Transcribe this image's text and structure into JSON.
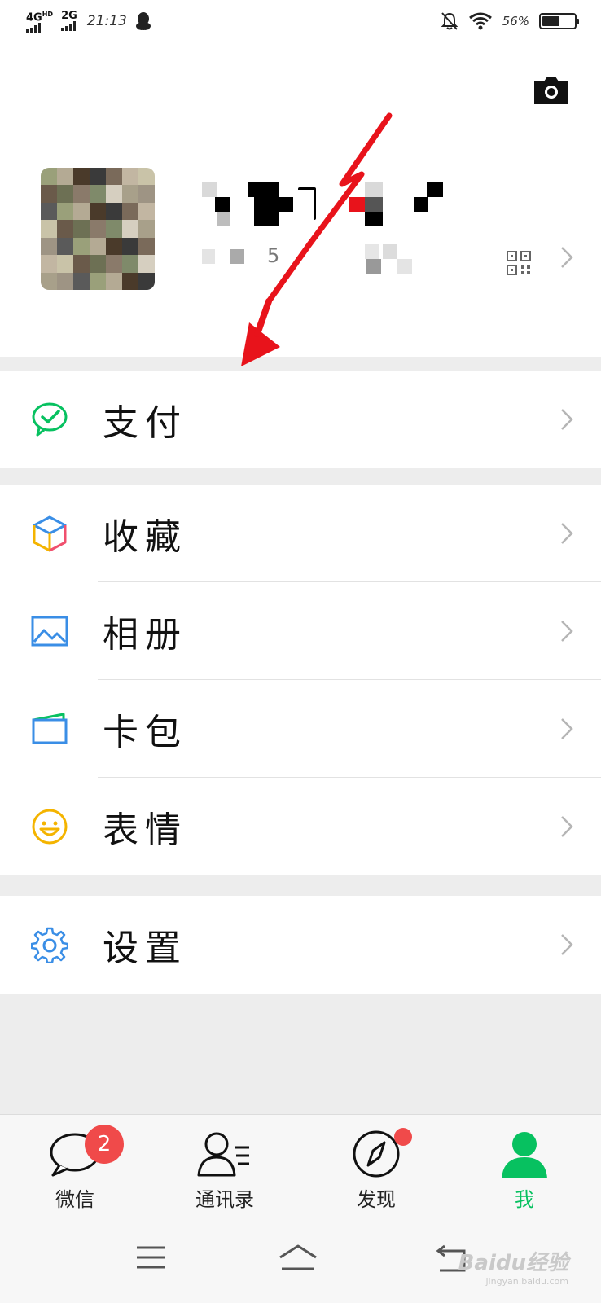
{
  "status_bar": {
    "network_1": "4G",
    "network_1_sup": "HD",
    "network_2": "2G",
    "time": "21:13",
    "battery_text": "56%",
    "battery_level": 0.56,
    "icons": [
      "qq-icon",
      "mute-bell-icon",
      "wifi-icon",
      "battery-icon"
    ]
  },
  "profile": {
    "camera_icon": "camera-icon",
    "nickname": "",
    "wechat_id": "",
    "qr_icon": "qr-code-icon"
  },
  "menu": {
    "pay": {
      "label": "支付",
      "icon": "wechat-pay-icon"
    },
    "favorites": {
      "label": "收藏",
      "icon": "cube-icon"
    },
    "album": {
      "label": "相册",
      "icon": "picture-icon"
    },
    "cards": {
      "label": "卡包",
      "icon": "wallet-icon"
    },
    "stickers": {
      "label": "表情",
      "icon": "smiley-icon"
    },
    "settings": {
      "label": "设置",
      "icon": "gear-icon"
    }
  },
  "tabs": {
    "chats": {
      "label": "微信",
      "badge": "2"
    },
    "contacts": {
      "label": "通讯录"
    },
    "discover": {
      "label": "发现",
      "has_dot": true
    },
    "me": {
      "label": "我",
      "active": true
    }
  },
  "colors": {
    "accent": "#07c160",
    "badge": "#f04a4a",
    "annotation": "#e8131b"
  },
  "watermark": {
    "text": "Baidu经验",
    "sub": "jingyan.baidu.com"
  }
}
